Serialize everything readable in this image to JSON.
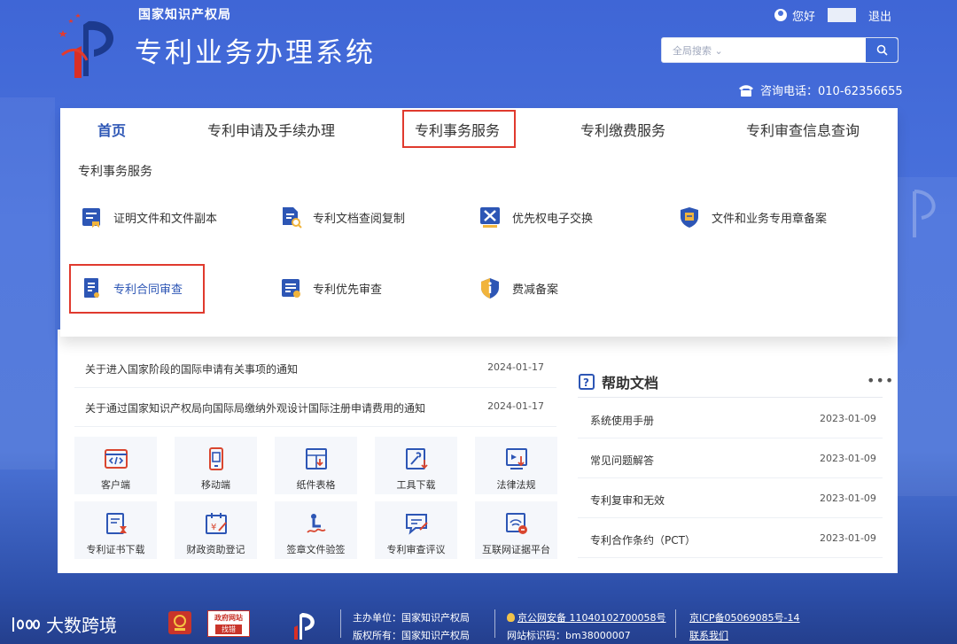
{
  "header": {
    "org_name": "国家知识产权局",
    "system_title": "专利业务办理系统",
    "greeting": "您好",
    "logout": "退出",
    "search_scope": "全局搜索",
    "search_placeholder": "",
    "hotline": "咨询电话：010-62356655"
  },
  "nav": [
    {
      "label": "首页",
      "active": true
    },
    {
      "label": "专利申请及手续办理"
    },
    {
      "label": "专利事务服务",
      "highlighted": true
    },
    {
      "label": "专利缴费服务"
    },
    {
      "label": "专利审查信息查询"
    }
  ],
  "dropdown": {
    "title": "专利事务服务",
    "items": [
      {
        "label": "证明文件和文件副本",
        "icon": "document-icon"
      },
      {
        "label": "专利文档查阅复制",
        "icon": "file-search-icon"
      },
      {
        "label": "优先权电子交换",
        "icon": "exchange-icon"
      },
      {
        "label": "文件和业务专用章备案",
        "icon": "shield-seal-icon"
      },
      {
        "label": "专利合同审查",
        "icon": "contract-icon",
        "highlighted": true
      },
      {
        "label": "专利优先审查",
        "icon": "priority-list-icon"
      },
      {
        "label": "费减备案",
        "icon": "info-shield-icon"
      }
    ]
  },
  "news": [
    {
      "title": "关于进入国家阶段的国际申请有关事项的通知",
      "date": "2024-01-17"
    },
    {
      "title": "关于通过国家知识产权局向国际局缴纳外观设计国际注册申请费用的通知",
      "date": "2024-01-17"
    }
  ],
  "tiles": [
    {
      "label": "客户端",
      "icon": "code-window-icon"
    },
    {
      "label": "移动端",
      "icon": "mobile-icon"
    },
    {
      "label": "纸件表格",
      "icon": "form-download-icon"
    },
    {
      "label": "工具下载",
      "icon": "tool-download-icon"
    },
    {
      "label": "法律法规",
      "icon": "law-download-icon"
    },
    {
      "label": "专利证书下载",
      "icon": "certificate-icon"
    },
    {
      "label": "财政资助登记",
      "icon": "funding-calendar-icon"
    },
    {
      "label": "签章文件验签",
      "icon": "signature-icon"
    },
    {
      "label": "专利审查评议",
      "icon": "review-chat-icon"
    },
    {
      "label": "互联网证据平台",
      "icon": "evidence-platform-icon"
    }
  ],
  "help": {
    "title": "帮助文档",
    "more": "•••",
    "items": [
      {
        "title": "系统使用手册",
        "date": "2023-01-09"
      },
      {
        "title": "常见问题解答",
        "date": "2023-01-09"
      },
      {
        "title": "专利复审和无效",
        "date": "2023-01-09"
      },
      {
        "title": "专利合作条约（PCT）",
        "date": "2023-01-09"
      }
    ]
  },
  "footer": {
    "brand": "大数跨境",
    "gov_site_top": "政府网站",
    "gov_site_bottom": "找错",
    "sponsor": "主办单位：国家知识产权局",
    "copyright": "版权所有：国家知识产权局",
    "police_record": "京公网安备 11040102700058号",
    "site_code": "网站标识码：bm38000007",
    "icp": "京ICP备05069085号-14",
    "contact": "联系我们"
  },
  "colors": {
    "accent": "#3d68d5",
    "highlight_border": "#e03a2e",
    "active_nav": "#2d56b5"
  }
}
